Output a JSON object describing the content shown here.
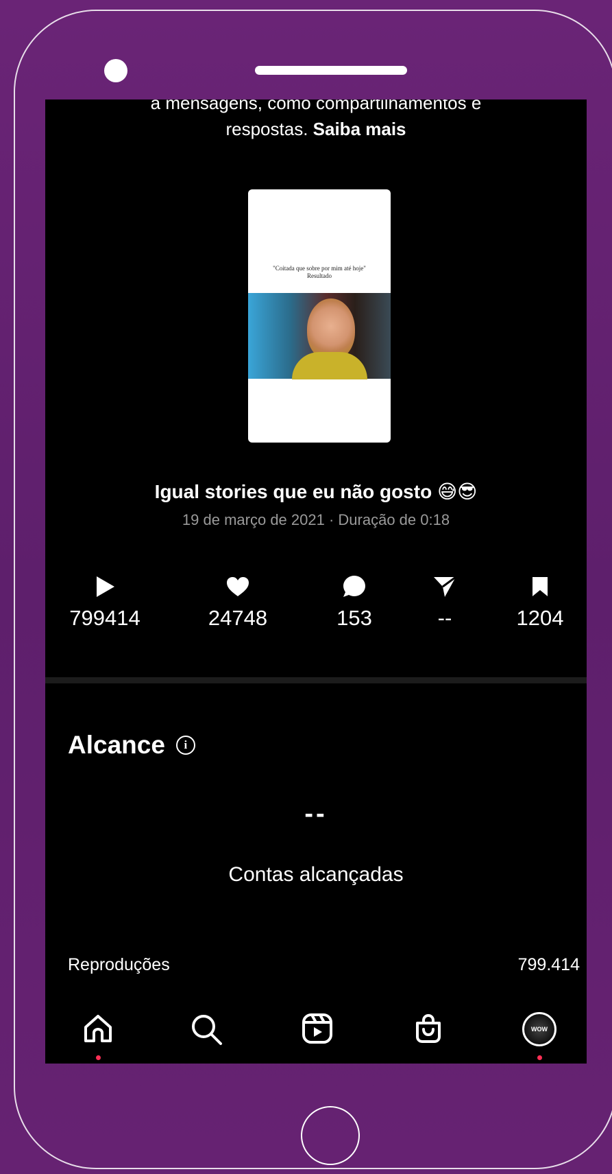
{
  "screen": {
    "top_text_line1": "a mensagens, como compartilhamentos e",
    "top_text_line2_plain": "respostas.",
    "top_text_line2_link": "Saiba mais"
  },
  "thumbnail": {
    "caption_line1": "\"Coitada que sobre por mim até hoje\"",
    "caption_line2": "Resultado"
  },
  "post": {
    "title": "Igual stories que eu não gosto 😅😎",
    "meta": "19 de março de 2021 · Duração de 0:18"
  },
  "stats": [
    {
      "icon": "play-icon",
      "value": "799414"
    },
    {
      "icon": "heart-icon",
      "value": "24748"
    },
    {
      "icon": "comment-icon",
      "value": "153"
    },
    {
      "icon": "send-icon",
      "value": "--"
    },
    {
      "icon": "bookmark-icon",
      "value": "1204"
    }
  ],
  "reach": {
    "title": "Alcance",
    "info_icon": "info-icon",
    "value": "--",
    "label": "Contas alcançadas",
    "rows": [
      {
        "label": "Reproduções",
        "value": "799.414"
      }
    ]
  },
  "nav": {
    "items": [
      "home-icon",
      "search-icon",
      "reels-icon",
      "shop-icon",
      "profile-avatar"
    ],
    "avatar_text": "WOW"
  },
  "colors": {
    "background": "#6a2476",
    "screen": "#000000",
    "notification_dot": "#ff2f55",
    "meta_text": "#9a9a9a"
  }
}
